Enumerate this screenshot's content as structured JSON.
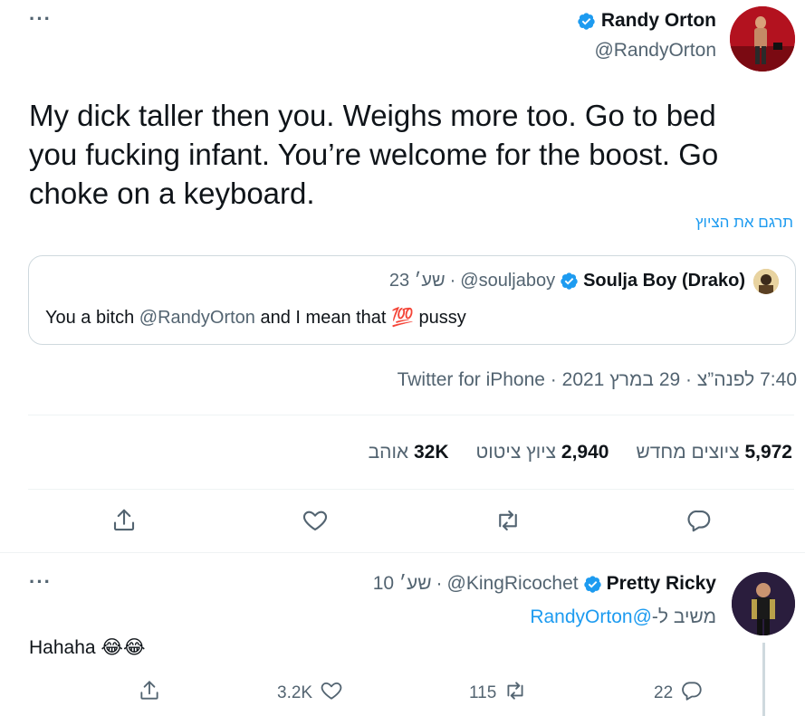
{
  "main_tweet": {
    "author_name": "Randy Orton",
    "author_handle": "@RandyOrton",
    "text_line1": "My dick taller then you. Weighs more too. Go to bed",
    "text_line2": "you fucking infant. You’re welcome for the boost. Go",
    "text_line3": "choke on a keyboard.",
    "translate_link": "תרגם את הציוץ",
    "timestamp": "7:40 לפנה”צ · 29 במרץ 2021 · Twitter for iPhone",
    "stats": {
      "retweets_count": "5,972",
      "retweets_label": "ציוצים מחדש",
      "quotes_count": "2,940",
      "quotes_label": "ציוץ ציטוט",
      "likes_count": "32K",
      "likes_label": "אוהב"
    }
  },
  "quoted_tweet": {
    "author_name": "Soulja Boy (Drako)",
    "author_handle": "@souljaboy",
    "time": "23 שע׳",
    "text_prefix": "You a bitch ",
    "mention": "@RandyOrton",
    "text_suffix": " and I mean that ",
    "emoji": "💯",
    "text_end": " pussy"
  },
  "reply_tweet": {
    "author_name": "Pretty Ricky",
    "author_handle": "@KingRicochet",
    "time": "10 שע׳",
    "replying_to_label": "משיב ל-",
    "replying_to_handle": "@RandyOrton",
    "text": "Hahaha",
    "emoji": "😂😂",
    "reply_count": "22",
    "retweet_count": "115",
    "like_count": "3.2K"
  },
  "colors": {
    "accent": "#1d9bf0",
    "text_primary": "#0f1419",
    "text_secondary": "#536471",
    "border": "#cfd9de"
  },
  "icons": {
    "more": "more-horizontal-icon",
    "verified": "verified-badge-icon",
    "reply": "reply-icon",
    "retweet": "retweet-icon",
    "like": "heart-icon",
    "share": "share-icon"
  }
}
